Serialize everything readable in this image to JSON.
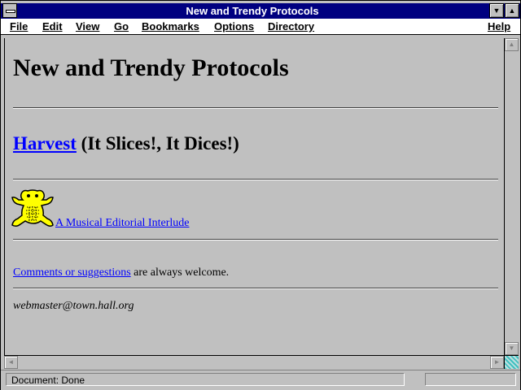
{
  "window": {
    "title": "New and Trendy Protocols",
    "minimize_glyph": "▼",
    "maximize_glyph": "▲"
  },
  "menubar": {
    "items": [
      {
        "label": "File"
      },
      {
        "label": "Edit"
      },
      {
        "label": "View"
      },
      {
        "label": "Go"
      },
      {
        "label": "Bookmarks"
      },
      {
        "label": "Options"
      },
      {
        "label": "Directory"
      }
    ],
    "help": "Help"
  },
  "page": {
    "title": "New and Trendy Protocols",
    "harvest_link": "Harvest",
    "harvest_tagline": " (It Slices!, It Dices!)",
    "interlude_link": "A Musical Editorial Interlude",
    "comments_link": "Comments or suggestions",
    "comments_rest": " are always welcome.",
    "address": "webmaster@town.hall.org"
  },
  "scrollbars": {
    "up_glyph": "▲",
    "down_glyph": "▼",
    "left_glyph": "◄",
    "right_glyph": "►"
  },
  "status": {
    "text": "Document: Done"
  },
  "colors": {
    "title_bar": "#000080",
    "link": "#0000ff",
    "frog": "#ffff00"
  },
  "icons": {
    "frog": "frog-icon"
  }
}
